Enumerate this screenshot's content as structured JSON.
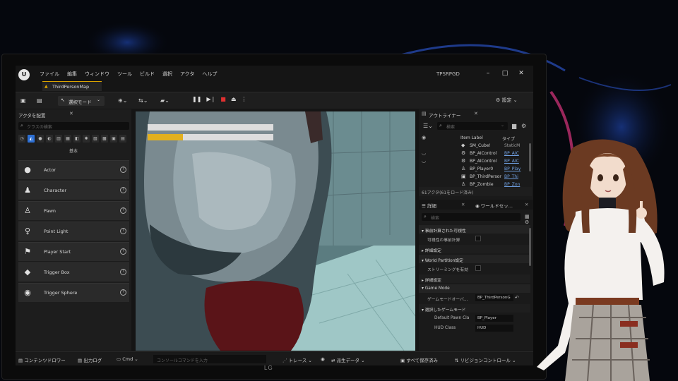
{
  "editor": {
    "menu": [
      "ファイル",
      "編集",
      "ウィンドウ",
      "ツール",
      "ビルド",
      "選択",
      "アクタ",
      "ヘルプ"
    ],
    "project_name": "TPSRPGD",
    "map_tab": "ThirdPersonMap",
    "toolbar": {
      "mode_label": "選択モード",
      "settings_label": "設定"
    }
  },
  "place_actors": {
    "title": "アクタを配置",
    "search_placeholder": "クラスの検索",
    "section": "基本",
    "items": [
      {
        "label": "Actor",
        "icon": "sphere-icon"
      },
      {
        "label": "Character",
        "icon": "character-icon"
      },
      {
        "label": "Pawn",
        "icon": "pawn-icon"
      },
      {
        "label": "Point Light",
        "icon": "light-bulb-icon"
      },
      {
        "label": "Player Start",
        "icon": "flag-icon"
      },
      {
        "label": "Trigger Box",
        "icon": "trigger-box-icon"
      },
      {
        "label": "Trigger Sphere",
        "icon": "trigger-sphere-icon"
      }
    ]
  },
  "viewport": {
    "health_fraction": 1.0,
    "stamina_fraction": 0.28,
    "health_color": "#dddddd",
    "stamina_color": "#e2b01f"
  },
  "outliner": {
    "title": "アウトライナー",
    "search_placeholder": "検索",
    "col_label": "Item Label",
    "col_type": "タイプ",
    "rows": [
      {
        "name": "SM_Cube!",
        "type": "StaticM",
        "link": false
      },
      {
        "name": "BP_AIControl",
        "type": "BP_AIC",
        "link": true
      },
      {
        "name": "BP_AIControl",
        "type": "BP_AIC",
        "link": true
      },
      {
        "name": "BP_Player0",
        "type": "BP_Play",
        "link": true
      },
      {
        "name": "BP_ThirdPerson",
        "type": "BP_Thi",
        "link": true
      },
      {
        "name": "BP_Zombie",
        "type": "BP_Zon",
        "link": true
      }
    ],
    "actor_count": "61アクタ(61をロード済み)"
  },
  "details": {
    "tab_details": "詳細",
    "tab_world": "ワールドセッ...",
    "search_placeholder": "検索",
    "sections": [
      {
        "type": "cat",
        "label": "事前計算された可視性"
      },
      {
        "type": "check",
        "label": "可視性の事前計算"
      },
      {
        "type": "cat",
        "label": "詳細設定"
      },
      {
        "type": "cat",
        "label": "World Partition設定"
      },
      {
        "type": "check",
        "label": "ストリーミングを有効"
      },
      {
        "type": "cat",
        "label": "詳細設定"
      },
      {
        "type": "cat",
        "label": "Game Mode"
      },
      {
        "type": "value",
        "label": "ゲームモードオーバ...",
        "value": "BP_ThirdPersonG"
      },
      {
        "type": "cat",
        "label": "選択したゲームモード"
      },
      {
        "type": "value",
        "label": "Default Pawn Cla",
        "value": "BP_Player"
      },
      {
        "type": "value",
        "label": "HUD Class",
        "value": "HUD"
      }
    ]
  },
  "statusbar": {
    "content_drawer": "コンテンツドロワー",
    "output_log": "出力ログ",
    "cmd": "Cmd",
    "cmd_placeholder": "コンソールコマンドを入力",
    "trace": "トレース",
    "derived_data": "派生データ",
    "save_all": "すべて保存済み",
    "revision_control": "リビジョンコントロール"
  },
  "monitor_brand": "LG"
}
